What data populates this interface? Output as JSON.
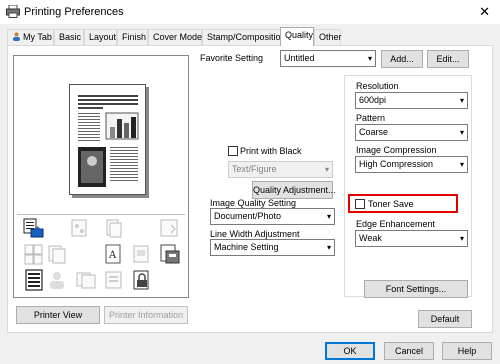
{
  "window": {
    "title": "Printing Preferences"
  },
  "tabs": [
    {
      "label": "My Tab"
    },
    {
      "label": "Basic"
    },
    {
      "label": "Layout"
    },
    {
      "label": "Finish"
    },
    {
      "label": "Cover Mode"
    },
    {
      "label": "Stamp/Composition"
    },
    {
      "label": "Quality",
      "active": true
    },
    {
      "label": "Other"
    }
  ],
  "favorite": {
    "label": "Favorite Setting",
    "value": "Untitled",
    "add_label": "Add...",
    "edit_label": "Edit..."
  },
  "preview": {
    "printer_view_label": "Printer View",
    "printer_info_label": "Printer Information"
  },
  "print_with_black": {
    "label": "Print with Black",
    "checked": false,
    "mode_value": "Text/Figure"
  },
  "quality_adjustment_label": "Quality Adjustment...",
  "image_quality": {
    "label": "Image Quality Setting",
    "value": "Document/Photo"
  },
  "line_width": {
    "label": "Line Width Adjustment",
    "value": "Machine Setting"
  },
  "resolution": {
    "label": "Resolution",
    "value": "600dpi"
  },
  "pattern": {
    "label": "Pattern",
    "value": "Coarse"
  },
  "image_compression": {
    "label": "Image Compression",
    "value": "High Compression"
  },
  "toner_save": {
    "label": "Toner Save",
    "checked": false
  },
  "edge_enhancement": {
    "label": "Edge Enhancement",
    "value": "Weak"
  },
  "font_settings_label": "Font Settings...",
  "default_label": "Default",
  "footer": {
    "ok_label": "OK",
    "cancel_label": "Cancel",
    "help_label": "Help"
  },
  "colors": {
    "highlight": "#e00000",
    "focus": "#0078d7"
  }
}
